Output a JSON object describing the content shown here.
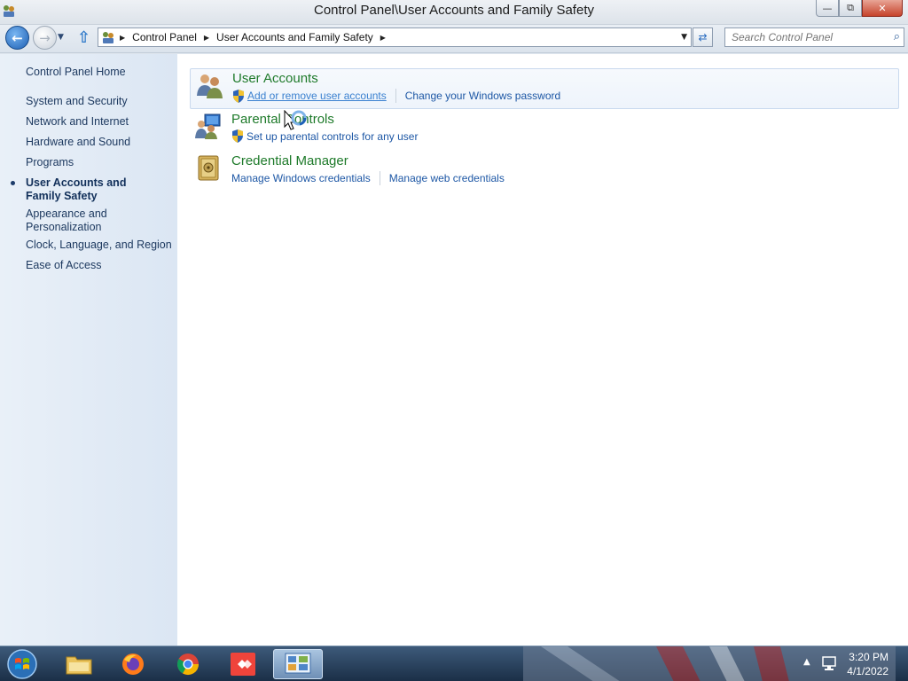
{
  "window": {
    "title": "Control Panel\\User Accounts and Family Safety",
    "minimize": "—",
    "restore": "⧉",
    "close": "✕"
  },
  "navbar": {
    "back": "←",
    "forward": "→",
    "history_dropdown": "▼",
    "up": "⇧",
    "breadcrumbs": [
      {
        "label": "Control Panel"
      },
      {
        "label": "User Accounts and Family Safety"
      }
    ],
    "crumb_separator": "▶",
    "address_dropdown": "▼",
    "refresh": "⇄",
    "search_placeholder": "Search Control Panel",
    "search_icon": "⌕"
  },
  "sidebar": {
    "items": [
      {
        "label": "Control Panel Home"
      },
      {
        "label": "System and Security"
      },
      {
        "label": "Network and Internet"
      },
      {
        "label": "Hardware and Sound"
      },
      {
        "label": "Programs"
      },
      {
        "label": "User Accounts and Family Safety",
        "current": true
      },
      {
        "label": "Appearance and Personalization"
      },
      {
        "label": "Clock, Language, and Region"
      },
      {
        "label": "Ease of Access"
      }
    ]
  },
  "categories": [
    {
      "title": "User Accounts",
      "icon": "users-icon",
      "links": [
        {
          "label": "Add or remove user accounts",
          "shield": true
        },
        {
          "label": "Change your Windows password",
          "shield": false
        }
      ]
    },
    {
      "title": "Parental Controls",
      "icon": "parental-controls-icon",
      "links": [
        {
          "label": "Set up parental controls for any user",
          "shield": true
        }
      ]
    },
    {
      "title": "Credential Manager",
      "icon": "vault-icon",
      "links": [
        {
          "label": "Manage Windows credentials",
          "shield": false
        },
        {
          "label": "Manage web credentials",
          "shield": false
        }
      ]
    }
  ],
  "taskbar": {
    "apps": [
      "start-orb",
      "file-explorer",
      "firefox",
      "chrome",
      "anydesk",
      "control-panel"
    ],
    "tray_arrow": "▲",
    "time": "3:20 PM",
    "date": "4/1/2022"
  },
  "colors": {
    "category_title": "#1e7a2a",
    "link": "#1d57a5",
    "sidebar_text": "#1e3a60"
  }
}
